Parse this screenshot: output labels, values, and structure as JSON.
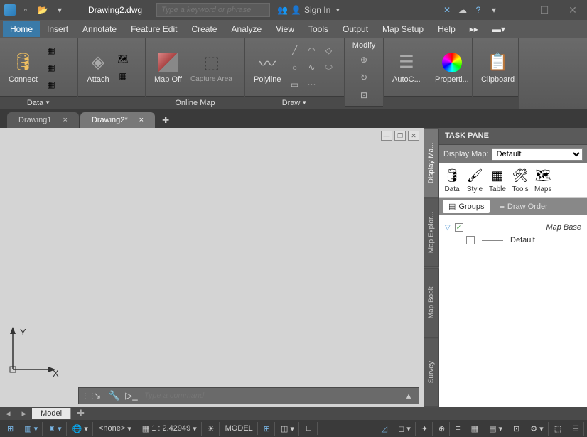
{
  "titlebar": {
    "filename": "Drawing2.dwg",
    "search_placeholder": "Type a keyword or phrase",
    "signin": "Sign In"
  },
  "menu": {
    "items": [
      "Home",
      "Insert",
      "Annotate",
      "Feature Edit",
      "Create",
      "Analyze",
      "View",
      "Tools",
      "Output",
      "Map Setup",
      "Help"
    ],
    "active": 0
  },
  "ribbon": {
    "panels": {
      "data": {
        "label": "Data",
        "connect": "Connect"
      },
      "attach": {
        "label": "",
        "attach": "Attach"
      },
      "onlinemap": {
        "label": "Online Map",
        "mapoff": "Map Off",
        "capture": "Capture Area"
      },
      "draw": {
        "label": "Draw",
        "polyline": "Polyline"
      },
      "modify": {
        "label": "",
        "title": "Modify"
      },
      "autoc": {
        "label": "",
        "title": "AutoC..."
      },
      "properties": {
        "label": "",
        "title": "Properti..."
      },
      "clipboard": {
        "label": "",
        "title": "Clipboard"
      }
    }
  },
  "filetabs": {
    "tabs": [
      {
        "label": "Drawing1"
      },
      {
        "label": "Drawing2*"
      }
    ],
    "active": 1
  },
  "canvas": {
    "axis_x": "X",
    "axis_y": "Y"
  },
  "cmdbar": {
    "placeholder": "Type a command"
  },
  "taskpane": {
    "title": "TASK PANE",
    "display_map_label": "Display Map:",
    "display_map_value": "Default",
    "tools": [
      "Data",
      "Style",
      "Table",
      "Tools",
      "Maps"
    ],
    "tabs": {
      "groups": "Groups",
      "draworder": "Draw Order",
      "active": 0
    },
    "side_tabs": [
      "Display Ma...",
      "Map Explor...",
      "Map Book",
      "Survey"
    ],
    "side_active": 0,
    "tree": {
      "root": "Map Base",
      "child": "Default"
    }
  },
  "bottom": {
    "model": "Model"
  },
  "status": {
    "coords_label": "<none>",
    "scale": "1 : 2.42949",
    "model": "MODEL"
  }
}
